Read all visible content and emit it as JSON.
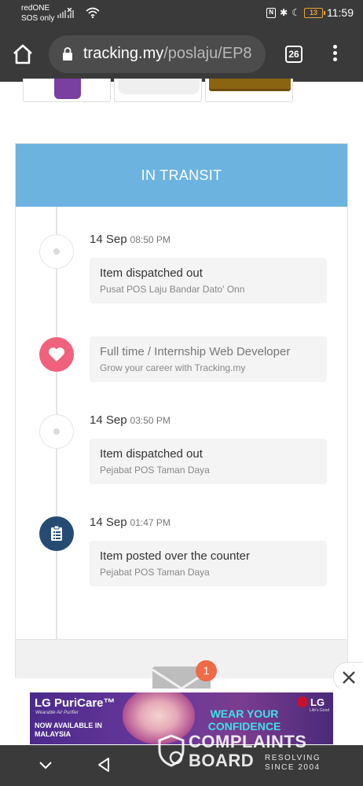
{
  "status_bar": {
    "carrier": "redONE",
    "sos": "SOS only",
    "battery": "13",
    "time": "11:59"
  },
  "browser": {
    "url_domain": "tracking.my",
    "url_path": "/poslaju/EP8",
    "tab_count": "26"
  },
  "tracking": {
    "status": "IN TRANSIT",
    "status_color": "#6cb3e0",
    "events": [
      {
        "date": "14 Sep",
        "time": "08:50 PM",
        "title": "Item dispatched out",
        "location": "Pusat POS Laju Bandar Dato' Onn",
        "node": "empty-dot"
      },
      {
        "date": "",
        "time": "",
        "title": "Full time / Internship Web Developer",
        "location": "Grow your career with Tracking.my",
        "node": "heart-icon"
      },
      {
        "date": "14 Sep",
        "time": "03:50 PM",
        "title": "Item dispatched out",
        "location": "Pejabat POS Taman Daya",
        "node": "empty-dot"
      },
      {
        "date": "14 Sep",
        "time": "01:47 PM",
        "title": "Item posted over the counter",
        "location": "Pejabat POS Taman Daya",
        "node": "clipboard-icon"
      }
    ]
  },
  "mail": {
    "badge_count": "1"
  },
  "ad": {
    "brand": "LG PuriCare™",
    "tagline": "Wearable Air Purifier",
    "available": "NOW AVAILABLE IN MALAYSIA",
    "headline": "WEAR YOUR CONFIDENCE",
    "logo": "LG",
    "logo_sub": "Life's Good"
  },
  "watermark": {
    "line1": "COMPLAINTS",
    "line2": "BOARD",
    "sub1": "RESOLVING",
    "sub2": "SINCE 2004"
  }
}
